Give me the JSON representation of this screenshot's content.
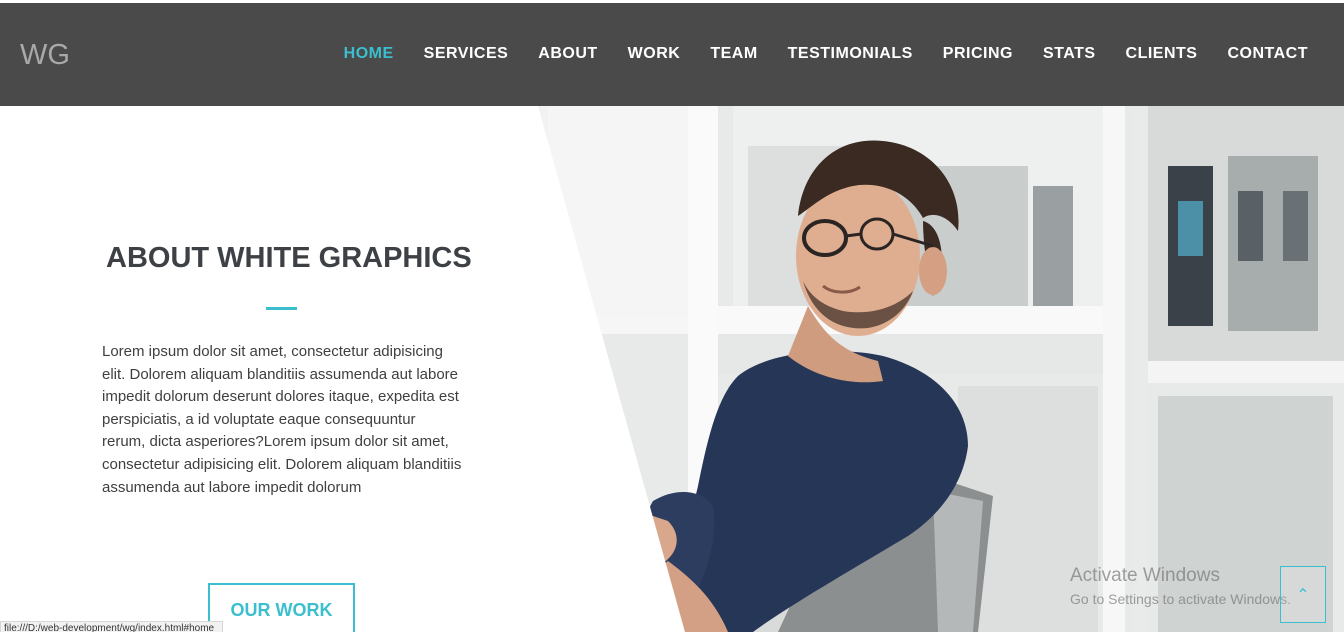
{
  "navbar": {
    "brand": "WG",
    "items": [
      {
        "label": "HOME",
        "active": true
      },
      {
        "label": "SERVICES"
      },
      {
        "label": "ABOUT"
      },
      {
        "label": "WORK"
      },
      {
        "label": "TEAM"
      },
      {
        "label": "TESTIMONIALS"
      },
      {
        "label": "PRICING"
      },
      {
        "label": "STATS"
      },
      {
        "label": "CLIENTS"
      },
      {
        "label": "CONTACT"
      }
    ]
  },
  "about": {
    "title": "ABOUT WHITE GRAPHICS",
    "body": "Lorem ipsum dolor sit amet, consectetur adipisicing elit. Dolorem aliquam blanditiis assumenda aut labore impedit dolorum deserunt dolores itaque, expedita est perspiciatis, a id voluptate eaque consequuntur rerum, dicta asperiores?Lorem ipsum dolor sit amet, consectetur adipisicing elit. Dolorem aliquam blanditiis assumenda aut labore impedit dolorum",
    "button_label": "OUR WORK"
  },
  "status_bar": {
    "url": "file:///D:/web-development/wg/index.html#home"
  },
  "watermark": {
    "title": "Activate Windows",
    "subtitle": "Go to Settings to activate Windows."
  },
  "scroll_top": {
    "icon": "chevron-up-icon",
    "glyph": "⌃"
  },
  "colors": {
    "accent": "#3bbfcf",
    "navbar_bg": "#4a4a4a",
    "title_text": "#3d4146"
  }
}
